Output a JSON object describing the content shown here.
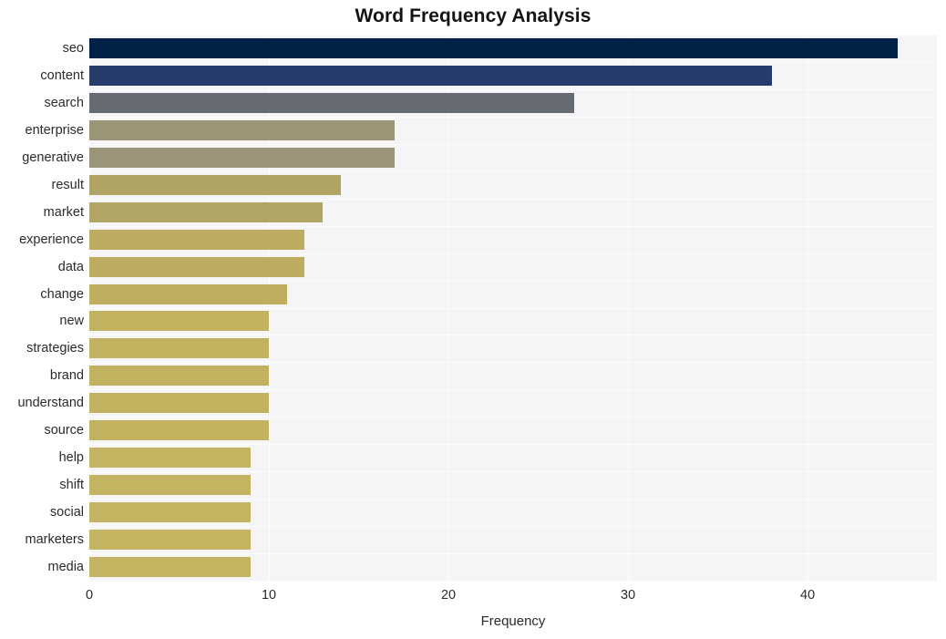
{
  "chart_data": {
    "type": "bar",
    "orientation": "horizontal",
    "title": "Word Frequency Analysis",
    "xlabel": "Frequency",
    "ylabel": "",
    "categories": [
      "seo",
      "content",
      "search",
      "enterprise",
      "generative",
      "result",
      "market",
      "experience",
      "data",
      "change",
      "new",
      "strategies",
      "brand",
      "understand",
      "source",
      "help",
      "shift",
      "social",
      "marketers",
      "media"
    ],
    "values": [
      45,
      38,
      27,
      17,
      17,
      14,
      13,
      12,
      12,
      11,
      10,
      10,
      10,
      10,
      10,
      9,
      9,
      9,
      9,
      9
    ],
    "bar_colors": [
      "#012147",
      "#283c6b",
      "#666a73",
      "#9b9477",
      "#9c9478",
      "#b0a465",
      "#b1a563",
      "#bdac5f",
      "#bdac5f",
      "#bfae5e",
      "#c2b15f",
      "#c2b15f",
      "#c2b15f",
      "#c2b15f",
      "#c2b15f",
      "#c4b360",
      "#c4b360",
      "#c4b360",
      "#c4b360",
      "#c4b360"
    ],
    "xticks": [
      0,
      10,
      20,
      30,
      40
    ],
    "xlim": [
      0,
      47.2
    ],
    "grid": true,
    "legend": false,
    "plot_background": "#f5f5f7",
    "gridline_color": "#fdfdfd",
    "title_color": "#141414",
    "tick_color": "#2b2b2b"
  }
}
